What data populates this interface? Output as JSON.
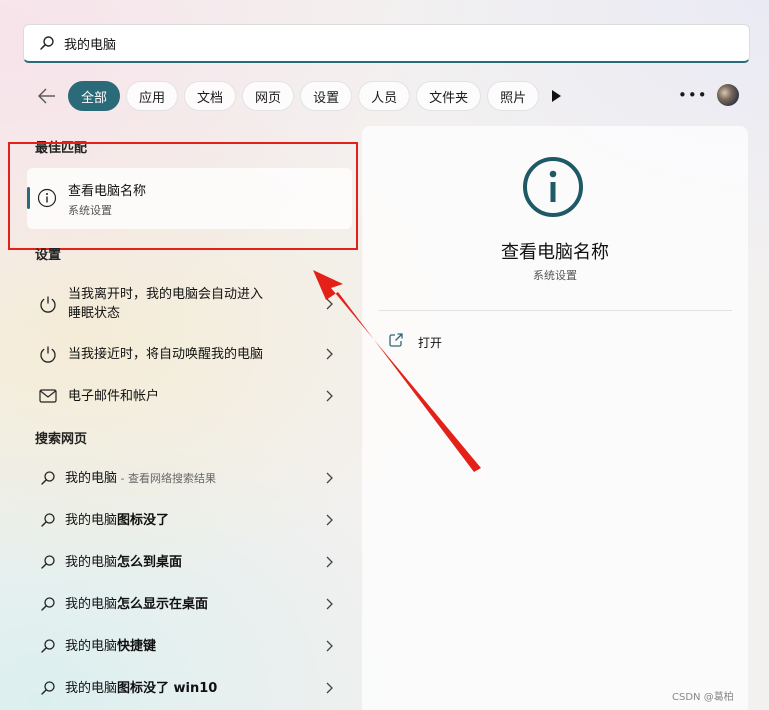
{
  "search": {
    "value": "我的电脑",
    "icon": "search-icon"
  },
  "filters": [
    {
      "label": "全部",
      "active": true
    },
    {
      "label": "应用"
    },
    {
      "label": "文档"
    },
    {
      "label": "网页"
    },
    {
      "label": "设置"
    },
    {
      "label": "人员"
    },
    {
      "label": "文件夹"
    },
    {
      "label": "照片"
    }
  ],
  "best_match": {
    "heading": "最佳匹配",
    "title": "查看电脑名称",
    "subtitle": "系统设置",
    "icon": "info-icon"
  },
  "settings": {
    "heading": "设置",
    "items": [
      {
        "line1": "当我离开时，我的电脑会自动进入",
        "line2": "睡眠状态",
        "icon": "power-icon"
      },
      {
        "line1": "当我接近时，将自动唤醒我的电脑",
        "icon": "power-icon"
      },
      {
        "line1": "电子邮件和帐户",
        "icon": "mail-icon"
      }
    ]
  },
  "web": {
    "heading": "搜索网页",
    "items": [
      {
        "prefix": "我的电脑",
        "suffix": "",
        "hint": " - 查看网络搜索结果"
      },
      {
        "prefix": "我的电脑",
        "suffix": "图标没了"
      },
      {
        "prefix": "我的电脑",
        "suffix": "怎么到桌面"
      },
      {
        "prefix": "我的电脑",
        "suffix": "怎么显示在桌面"
      },
      {
        "prefix": "我的电脑",
        "suffix": "快捷键"
      },
      {
        "prefix": "我的电脑",
        "suffix": "图标没了 win10"
      }
    ]
  },
  "detail": {
    "title": "查看电脑名称",
    "subtitle": "系统设置",
    "open_label": "打开"
  },
  "colors": {
    "accent": "#2b6a78",
    "highlight": "#e32119"
  },
  "watermark": "CSDN @葛柏"
}
